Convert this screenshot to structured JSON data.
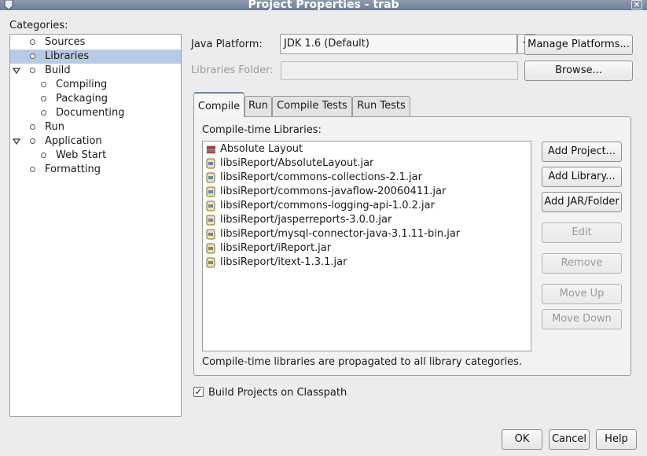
{
  "window": {
    "title": "Project Properties - trab",
    "close_glyph": "×"
  },
  "categories": {
    "label": "Categories:",
    "items": [
      {
        "label": "Sources"
      },
      {
        "label": "Libraries"
      },
      {
        "label": "Build"
      },
      {
        "label": "Compiling"
      },
      {
        "label": "Packaging"
      },
      {
        "label": "Documenting"
      },
      {
        "label": "Run"
      },
      {
        "label": "Application"
      },
      {
        "label": "Web Start"
      },
      {
        "label": "Formatting"
      }
    ]
  },
  "java_platform": {
    "label": "Java Platform:",
    "value": "JDK 1.6 (Default)",
    "manage_button": "Manage Platforms..."
  },
  "libraries_folder": {
    "label": "Libraries Folder:",
    "value": "",
    "browse_button": "Browse..."
  },
  "tabs": [
    "Compile",
    "Run",
    "Compile Tests",
    "Run Tests"
  ],
  "compile": {
    "list_label": "Compile-time Libraries:",
    "libraries": [
      "Absolute Layout",
      "libsiReport/AbsoluteLayout.jar",
      "libsiReport/commons-collections-2.1.jar",
      "libsiReport/commons-javaflow-20060411.jar",
      "libsiReport/commons-logging-api-1.0.2.jar",
      "libsiReport/jasperreports-3.0.0.jar",
      "libsiReport/mysql-connector-java-3.1.11-bin.jar",
      "libsiReport/iReport.jar",
      "libsiReport/itext-1.3.1.jar"
    ],
    "buttons": {
      "add_project": "Add Project...",
      "add_library": "Add Library...",
      "add_jar": "Add JAR/Folder",
      "edit": "Edit",
      "remove": "Remove",
      "move_up": "Move Up",
      "move_down": "Move Down"
    },
    "note": "Compile-time libraries are propagated to all library categories."
  },
  "build_classpath": {
    "label": "Build Projects on Classpath",
    "checked": true,
    "check_glyph": "✓"
  },
  "dialog_buttons": {
    "ok": "OK",
    "cancel": "Cancel",
    "help": "Help"
  }
}
